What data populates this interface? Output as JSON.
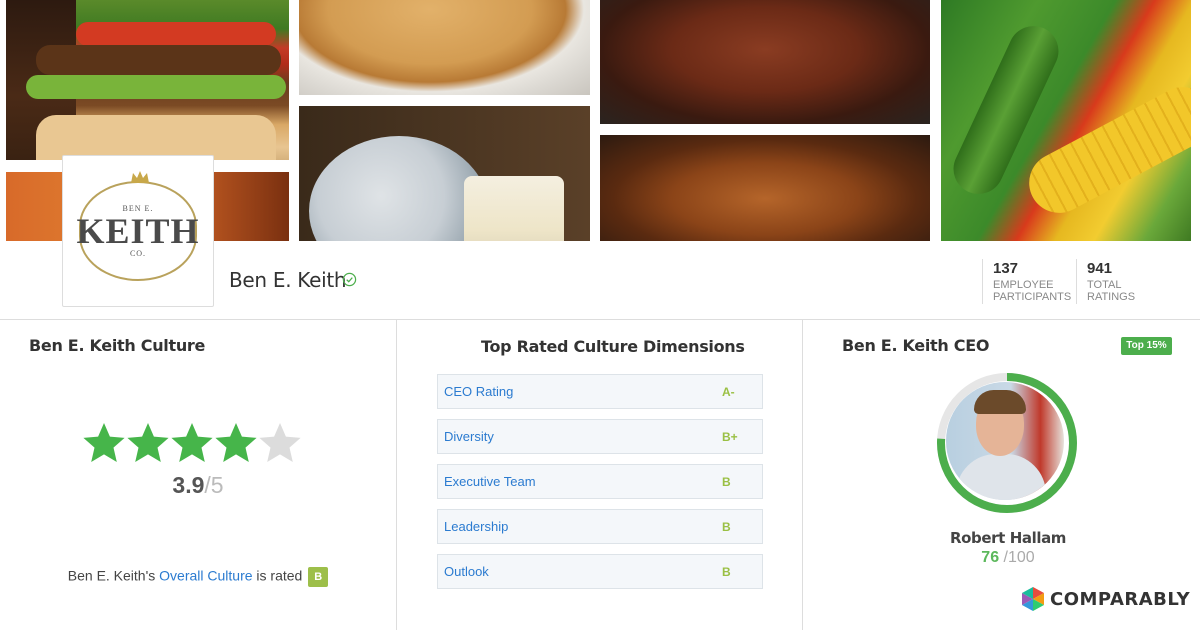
{
  "company": {
    "name": "Ben E. Keith",
    "logo_text_main": "KEITH",
    "logo_text_top": "BEN E.",
    "logo_text_bottom": "CO."
  },
  "stats": [
    {
      "value": "137",
      "label_line1": "EMPLOYEE",
      "label_line2": "PARTICIPANTS"
    },
    {
      "value": "941",
      "label_line1": "TOTAL",
      "label_line2": "RATINGS"
    }
  ],
  "culture": {
    "title": "Ben E. Keith Culture",
    "score": "3.9",
    "score_sep": "/5",
    "stars_value": 3.9,
    "stars_max": 5,
    "sentence_prefix": "Ben E. Keith's ",
    "sentence_link": "Overall Culture",
    "sentence_mid": " is rated ",
    "grade": "B"
  },
  "dimensions": {
    "title": "Top Rated Culture Dimensions",
    "rows": [
      {
        "label": "CEO Rating",
        "grade": "A-"
      },
      {
        "label": "Diversity",
        "grade": "B+"
      },
      {
        "label": "Executive Team",
        "grade": "B"
      },
      {
        "label": "Leadership",
        "grade": "B"
      },
      {
        "label": "Outlook",
        "grade": "B"
      }
    ]
  },
  "ceo": {
    "title": "Ben E. Keith CEO",
    "badge": "Top 15%",
    "name": "Robert Hallam",
    "score": "76",
    "score_max": "/100",
    "score_value": 76
  },
  "brand": {
    "name": "COMPARABLY"
  },
  "colors": {
    "green": "#4cae4c",
    "star_filled": "#46b54a",
    "star_empty": "#dcdcdc",
    "link": "#2b7bd0",
    "grade_chip": "#9dbf4a"
  }
}
